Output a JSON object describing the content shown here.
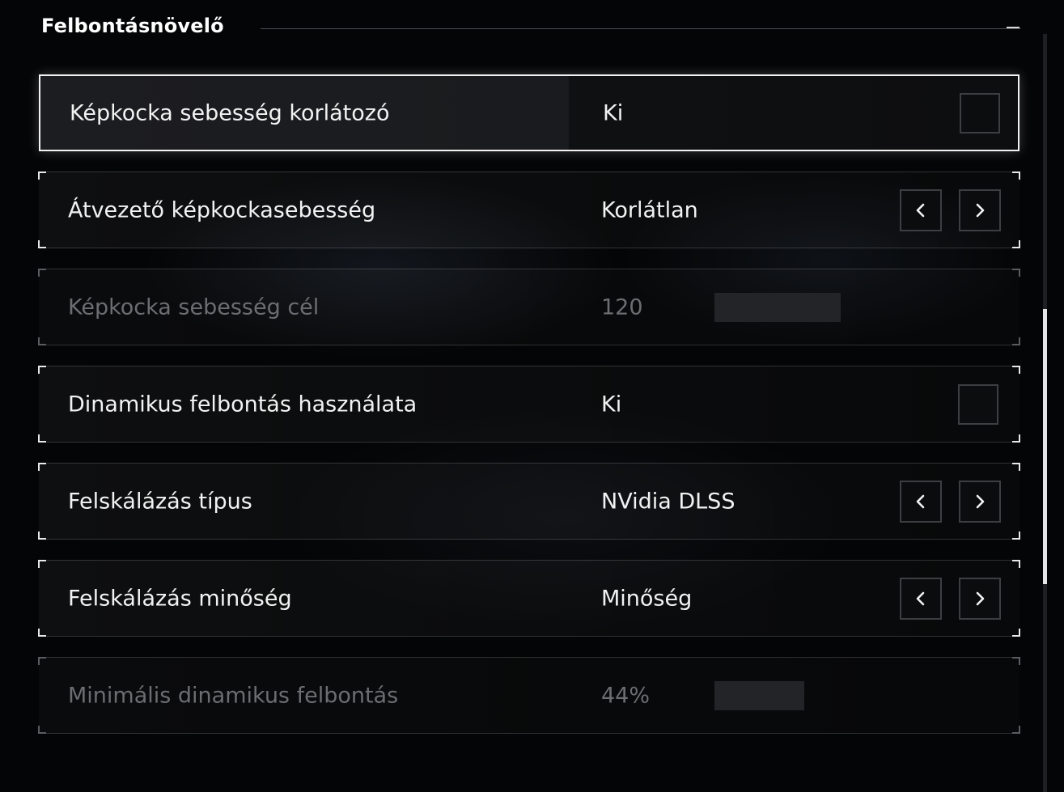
{
  "section": {
    "title": "Felbontásnövelő"
  },
  "rows": [
    {
      "label": "Képkocka sebesség korlátozó",
      "value": "Ki",
      "control": "checkbox",
      "checked": false,
      "selected": true,
      "disabled": false
    },
    {
      "label": "Átvezető képkockasebesség",
      "value": "Korlátlan",
      "control": "arrows",
      "selected": false,
      "disabled": false
    },
    {
      "label": "Képkocka sebesség cél",
      "value": "120",
      "control": "slider",
      "slider_fraction": 0.62,
      "selected": false,
      "disabled": true
    },
    {
      "label": "Dinamikus felbontás használata",
      "value": "Ki",
      "control": "checkbox",
      "checked": false,
      "selected": false,
      "disabled": false
    },
    {
      "label": "Felskálázás típus",
      "value": "NVidia DLSS",
      "control": "arrows",
      "selected": false,
      "disabled": false
    },
    {
      "label": "Felskálázás minőség",
      "value": "Minőség",
      "control": "arrows",
      "selected": false,
      "disabled": false
    },
    {
      "label": "Minimális dinamikus felbontás",
      "value": "44%",
      "control": "slider",
      "slider_fraction": 0.44,
      "selected": false,
      "disabled": true
    }
  ],
  "icons": {
    "prev": "chevron-left-icon",
    "next": "chevron-right-icon"
  },
  "colors": {
    "text": "#f2f2f2",
    "disabled_text": "#6b6d70",
    "selection_border": "#f2f2f2",
    "background": "#040506"
  }
}
